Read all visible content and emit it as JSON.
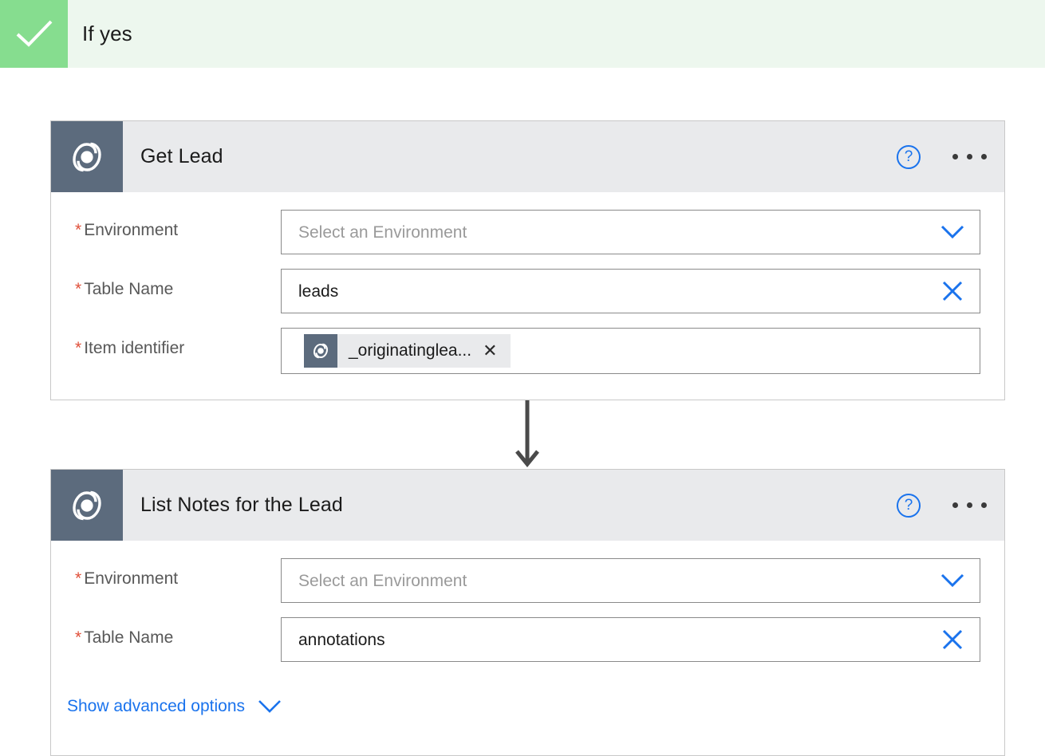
{
  "branch": {
    "label": "If yes",
    "icon": "check-icon",
    "accent_color": "#86dd8f",
    "background_color": "#edf7ee"
  },
  "theme": {
    "link_color": "#1a73ed",
    "required_color": "#e0503a",
    "connector_color": "#4a4a4a",
    "card_header_bg": "#e9eaec",
    "connector_icon": "arrow-down-icon"
  },
  "cards": [
    {
      "title": "Get Lead",
      "icon": "dataverse-icon",
      "icon_bg": "#5c6b7d",
      "help_label": "?",
      "help_icon": "help-circle-icon",
      "more_icon": "ellipsis-icon",
      "fields": [
        {
          "label": "Environment",
          "required": true,
          "type": "dropdown",
          "value": "",
          "placeholder": "Select an Environment",
          "icon": "chevron-down-icon"
        },
        {
          "label": "Table Name",
          "required": true,
          "type": "combobox",
          "value": "leads",
          "placeholder": "",
          "icon": "clear-x-icon"
        },
        {
          "label": "Item identifier",
          "required": true,
          "type": "token",
          "token_text": "_originatinglea...",
          "token_icon": "dataverse-icon",
          "token_remove_icon": "remove-x-icon"
        }
      ]
    },
    {
      "title": "List Notes for the Lead",
      "icon": "dataverse-icon",
      "icon_bg": "#5c6b7d",
      "help_label": "?",
      "help_icon": "help-circle-icon",
      "more_icon": "ellipsis-icon",
      "fields": [
        {
          "label": "Environment",
          "required": true,
          "type": "dropdown",
          "value": "",
          "placeholder": "Select an Environment",
          "icon": "chevron-down-icon"
        },
        {
          "label": "Table Name",
          "required": true,
          "type": "combobox",
          "value": "annotations",
          "placeholder": "",
          "icon": "clear-x-icon"
        }
      ],
      "advanced_options": {
        "label": "Show advanced options",
        "icon": "chevron-down-icon"
      }
    }
  ]
}
